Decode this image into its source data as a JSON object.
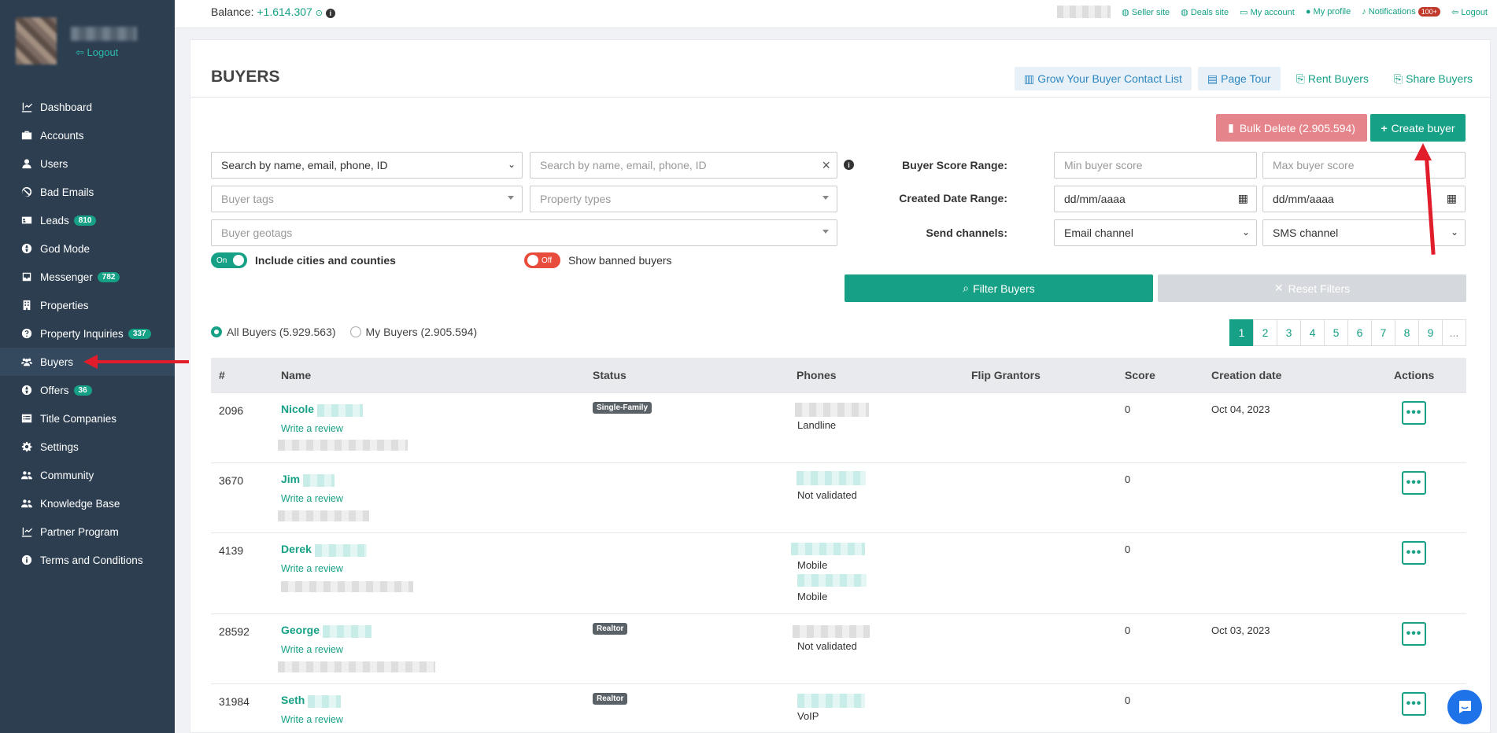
{
  "sidebar": {
    "logout": "Logout",
    "items": [
      {
        "label": "Dashboard",
        "icon": "chart-icon"
      },
      {
        "label": "Accounts",
        "icon": "briefcase-icon"
      },
      {
        "label": "Users",
        "icon": "user-icon"
      },
      {
        "label": "Bad Emails",
        "icon": "ban-icon"
      },
      {
        "label": "Leads",
        "icon": "address-card-icon",
        "badge": "810"
      },
      {
        "label": "God Mode",
        "icon": "globe-icon"
      },
      {
        "label": "Messenger",
        "icon": "inbox-icon",
        "badge": "782"
      },
      {
        "label": "Properties",
        "icon": "building-icon"
      },
      {
        "label": "Property Inquiries",
        "icon": "question-circle-icon",
        "badge": "337"
      },
      {
        "label": "Buyers",
        "icon": "users-icon",
        "active": true
      },
      {
        "label": "Offers",
        "icon": "globe-icon",
        "badge": "36"
      },
      {
        "label": "Title Companies",
        "icon": "list-icon"
      },
      {
        "label": "Settings",
        "icon": "gear-icon"
      },
      {
        "label": "Community",
        "icon": "users-icon"
      },
      {
        "label": "Knowledge Base",
        "icon": "users-icon"
      },
      {
        "label": "Partner Program",
        "icon": "chart-icon"
      },
      {
        "label": "Terms and Conditions",
        "icon": "info-icon"
      }
    ]
  },
  "topbar": {
    "balance_label": "Balance:",
    "balance_value": "+1.614.307",
    "links": {
      "seller_site": "Seller site",
      "deals_site": "Deals site",
      "my_account": "My account",
      "my_profile": "My profile",
      "notifications": "Notifications",
      "notifications_badge": "100+",
      "logout": "Logout"
    }
  },
  "page": {
    "title": "BUYERS",
    "header_buttons": {
      "grow": "Grow Your Buyer Contact List",
      "tour": "Page Tour",
      "rent": "Rent Buyers",
      "share": "Share Buyers"
    },
    "bulk_delete": "Bulk Delete (2.905.594)",
    "create_buyer": "Create buyer"
  },
  "filters": {
    "search_type": "Search by name, email, phone, ID",
    "search_placeholder": "Search by name, email, phone, ID",
    "buyer_tags": "Buyer tags",
    "property_types": "Property types",
    "buyer_geotags": "Buyer geotags",
    "include_cities_toggle": "On",
    "include_cities_label": "Include cities and counties",
    "show_banned_toggle": "Off",
    "show_banned_label": "Show banned buyers",
    "score_range_label": "Buyer Score Range:",
    "min_score": "Min buyer score",
    "max_score": "Max buyer score",
    "created_range_label": "Created Date Range:",
    "date_from": "dd/mm/aaaa",
    "date_to": "dd/mm/aaaa",
    "send_channels_label": "Send channels:",
    "email_channel": "Email channel",
    "sms_channel": "SMS channel",
    "filter_button": "Filter Buyers",
    "reset_button": "Reset Filters"
  },
  "scope": {
    "all": "All Buyers (5.929.563)",
    "mine": "My Buyers (2.905.594)"
  },
  "pagination": [
    "1",
    "2",
    "3",
    "4",
    "5",
    "6",
    "7",
    "8",
    "9",
    "..."
  ],
  "table": {
    "columns": [
      "#",
      "Name",
      "Status",
      "Phones",
      "Flip Grantors",
      "Score",
      "Creation date",
      "Actions"
    ],
    "review_label": "Write a review",
    "rows": [
      {
        "id": "2096",
        "first_name": "Nicole",
        "status": "Single-Family",
        "phones": [
          "Landline"
        ],
        "score": "0",
        "created": "Oct 04, 2023"
      },
      {
        "id": "3670",
        "first_name": "Jim",
        "status": "",
        "phones": [
          "Not validated"
        ],
        "score": "0",
        "created": ""
      },
      {
        "id": "4139",
        "first_name": "Derek",
        "status": "",
        "phones": [
          "Mobile",
          "Mobile"
        ],
        "score": "0",
        "created": ""
      },
      {
        "id": "28592",
        "first_name": "George",
        "status": "Realtor",
        "phones": [
          "Not validated"
        ],
        "score": "0",
        "created": "Oct 03, 2023"
      },
      {
        "id": "31984",
        "first_name": "Seth",
        "status": "Realtor",
        "phones": [
          "VoIP"
        ],
        "score": "0",
        "created": ""
      }
    ],
    "actions_glyph": "•••"
  },
  "colors": {
    "sidebar": "#2c3e50",
    "accent": "#16a085",
    "danger_light": "#e5848a",
    "annotation_arrow": "#e21d2b"
  }
}
